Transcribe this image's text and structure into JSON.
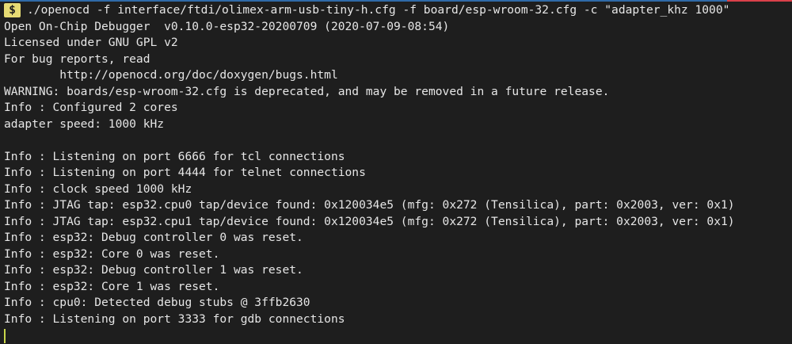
{
  "prompt": {
    "symbol": "$",
    "command": "./openocd -f interface/ftdi/olimex-arm-usb-tiny-h.cfg -f board/esp-wroom-32.cfg -c \"adapter_khz 1000\""
  },
  "output_lines": [
    "Open On-Chip Debugger  v0.10.0-esp32-20200709 (2020-07-09-08:54)",
    "Licensed under GNU GPL v2",
    "For bug reports, read",
    "        http://openocd.org/doc/doxygen/bugs.html",
    "WARNING: boards/esp-wroom-32.cfg is deprecated, and may be removed in a future release.",
    "Info : Configured 2 cores",
    "adapter speed: 1000 kHz",
    "",
    "Info : Listening on port 6666 for tcl connections",
    "Info : Listening on port 4444 for telnet connections",
    "Info : clock speed 1000 kHz",
    "Info : JTAG tap: esp32.cpu0 tap/device found: 0x120034e5 (mfg: 0x272 (Tensilica), part: 0x2003, ver: 0x1)",
    "Info : JTAG tap: esp32.cpu1 tap/device found: 0x120034e5 (mfg: 0x272 (Tensilica), part: 0x2003, ver: 0x1)",
    "Info : esp32: Debug controller 0 was reset.",
    "Info : esp32: Core 0 was reset.",
    "Info : esp32: Debug controller 1 was reset.",
    "Info : esp32: Core 1 was reset.",
    "Info : cpu0: Detected debug stubs @ 3ffb2630",
    "Info : Listening on port 3333 for gdb connections"
  ],
  "colors": {
    "background": "#1e1e1e",
    "text": "#e6e6e6",
    "prompt_badge": "#e6db74",
    "cursor": "#c9d64b"
  }
}
